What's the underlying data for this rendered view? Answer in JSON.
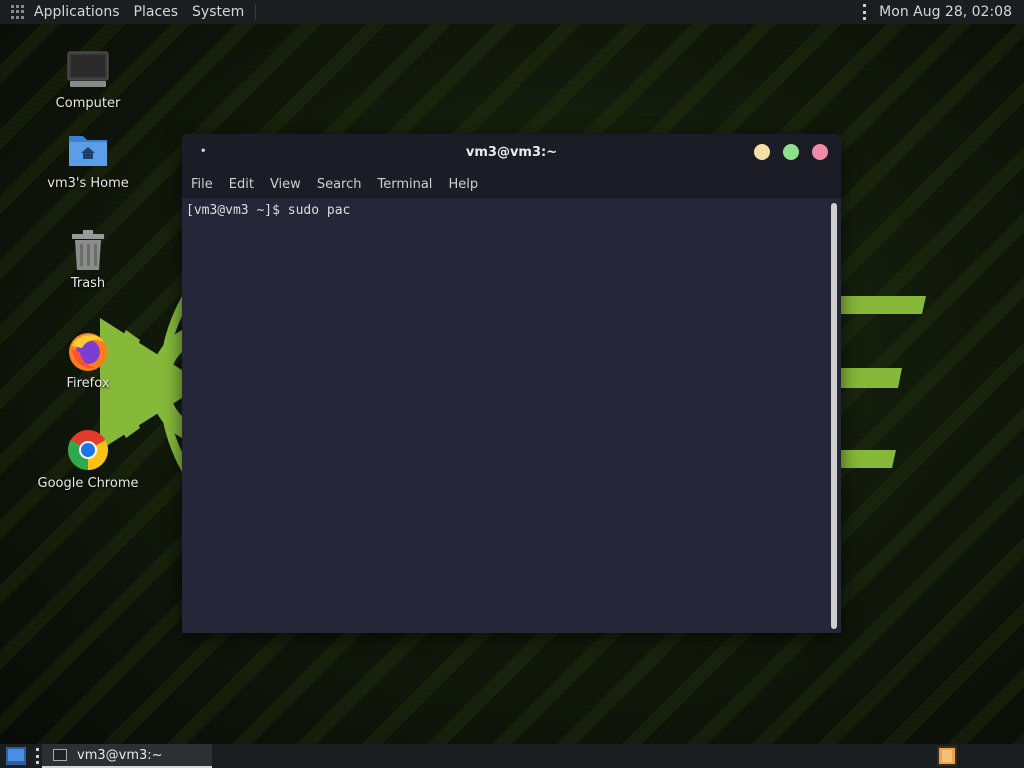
{
  "top_panel": {
    "applications_label": "Applications",
    "places_label": "Places",
    "system_label": "System",
    "clock": "Mon Aug 28, 02:08"
  },
  "desktop_icons": [
    {
      "label": "Computer",
      "icon": "computer-icon"
    },
    {
      "label": "vm3's Home",
      "icon": "home-folder-icon"
    },
    {
      "label": "Trash",
      "icon": "trash-icon"
    },
    {
      "label": "Firefox",
      "icon": "firefox-icon"
    },
    {
      "label": "Google Chrome",
      "icon": "chrome-icon"
    }
  ],
  "terminal": {
    "title": "vm3@vm3:~",
    "menu": [
      "File",
      "Edit",
      "View",
      "Search",
      "Terminal",
      "Help"
    ],
    "prompt_line": "[vm3@vm3 ~]$ sudo pac",
    "button_colors": {
      "minimize": "#f4dfa6",
      "maximize": "#8ee08c",
      "close": "#f08aa6"
    }
  },
  "bottom_panel": {
    "task_label": "vm3@vm3:~"
  },
  "colors": {
    "accent_green": "#8ab83a",
    "terminal_bg": "#252637",
    "panel_bg": "#1b1e20"
  }
}
